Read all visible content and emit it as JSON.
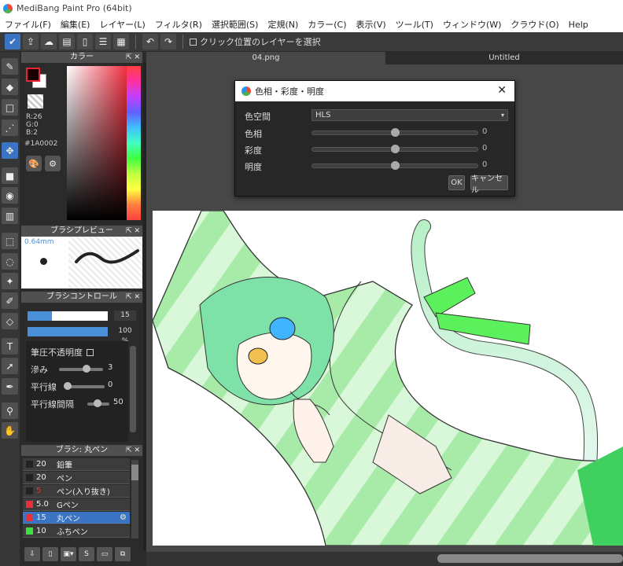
{
  "window": {
    "title": "MediBang Paint Pro (64bit)"
  },
  "menu": [
    "ファイル(F)",
    "編集(E)",
    "レイヤー(L)",
    "フィルタ(R)",
    "選択範囲(S)",
    "定規(N)",
    "カラー(C)",
    "表示(V)",
    "ツール(T)",
    "ウィンドウ(W)",
    "クラウド(O)",
    "Help"
  ],
  "toolbar": {
    "click_layer_label": "クリック位置のレイヤーを選択"
  },
  "color_panel": {
    "title": "カラー",
    "r": "R:26",
    "g": "G:0",
    "b": "B:2",
    "hex": "#1A0002"
  },
  "brush_preview": {
    "title": "ブラシプレビュー",
    "size": "0.64mm"
  },
  "brush_control": {
    "title": "ブラシコントロール",
    "size_value": "15",
    "opacity_value": "100 %",
    "pressure_label": "筆圧不透明度",
    "blur_label": "滲み",
    "blur_value": "3",
    "parallel_label": "平行線",
    "parallel_value": "0",
    "parallel_gap_label": "平行線間隔",
    "parallel_gap_value": "50"
  },
  "brush_list": {
    "title": "ブラシ: 丸ペン",
    "items": [
      {
        "size": "20",
        "name": "鉛筆",
        "color": "#222222"
      },
      {
        "size": "20",
        "name": "ペン",
        "color": "#222222"
      },
      {
        "size": "5",
        "name": "ペン(入り抜き)",
        "color": "#222222"
      },
      {
        "size": "5.0",
        "name": "Gペン",
        "color": "#e8303a"
      },
      {
        "size": "15",
        "name": "丸ペン",
        "color": "#e8303a"
      },
      {
        "size": "10",
        "name": "ふちペン",
        "color": "#40e040"
      }
    ]
  },
  "tabs": [
    "04.png",
    "Untitled"
  ],
  "dialog": {
    "title": "色相・彩度・明度",
    "colorspace_label": "色空間",
    "colorspace_value": "HLS",
    "hue_label": "色相",
    "hue_value": "0",
    "sat_label": "彩度",
    "sat_value": "0",
    "light_label": "明度",
    "light_value": "0",
    "ok": "OK",
    "cancel": "キャンセル"
  }
}
